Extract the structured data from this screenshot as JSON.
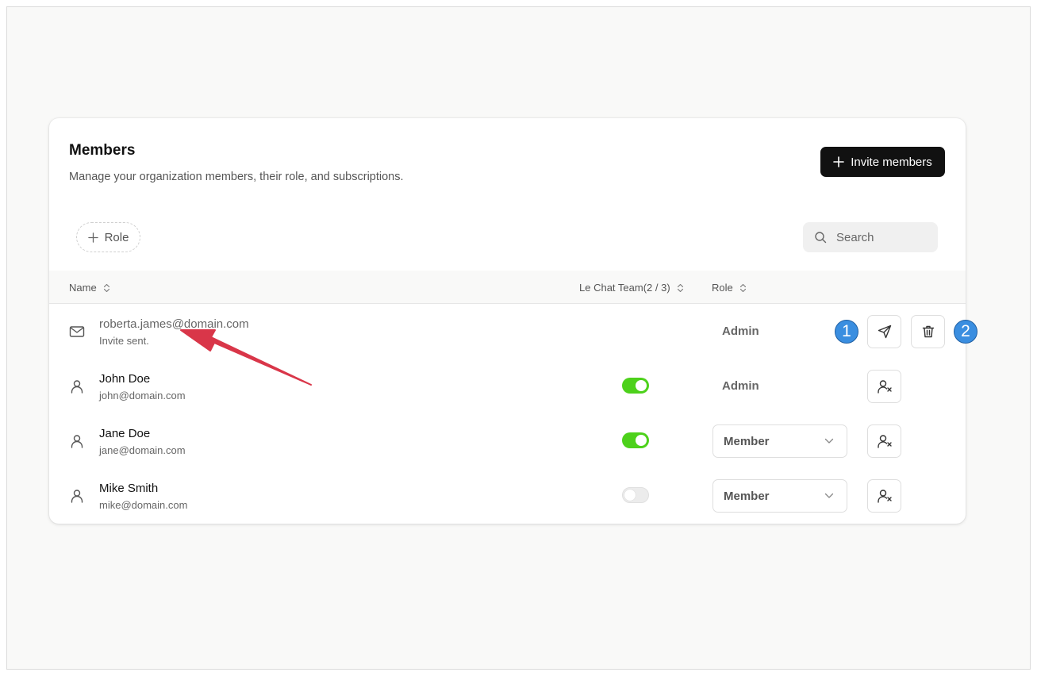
{
  "header": {
    "title": "Members",
    "subtitle": "Manage your organization members, their role, and subscriptions.",
    "invite_label": "Invite members"
  },
  "filters": {
    "role_chip_label": "Role",
    "search_placeholder": "Search"
  },
  "table": {
    "columns": {
      "name": "Name",
      "team": "Le Chat Team(2 / 3)",
      "role": "Role"
    },
    "rows": [
      {
        "kind": "invite",
        "email": "roberta.james@domain.com",
        "status": "Invite sent.",
        "role": "Admin"
      },
      {
        "kind": "member",
        "name": "John Doe",
        "email": "john@domain.com",
        "team_enabled": true,
        "role": "Admin",
        "role_editable": false
      },
      {
        "kind": "member",
        "name": "Jane Doe",
        "email": "jane@domain.com",
        "team_enabled": true,
        "role": "Member",
        "role_editable": true
      },
      {
        "kind": "member",
        "name": "Mike Smith",
        "email": "mike@domain.com",
        "team_enabled": false,
        "role": "Member",
        "role_editable": true
      }
    ]
  },
  "annotations": {
    "marker_1": "1",
    "marker_2": "2",
    "arrow_color": "#d93649"
  },
  "colors": {
    "toggle_on": "#4dd11b",
    "primary_button": "#111111",
    "marker": "#3a8ee0"
  }
}
